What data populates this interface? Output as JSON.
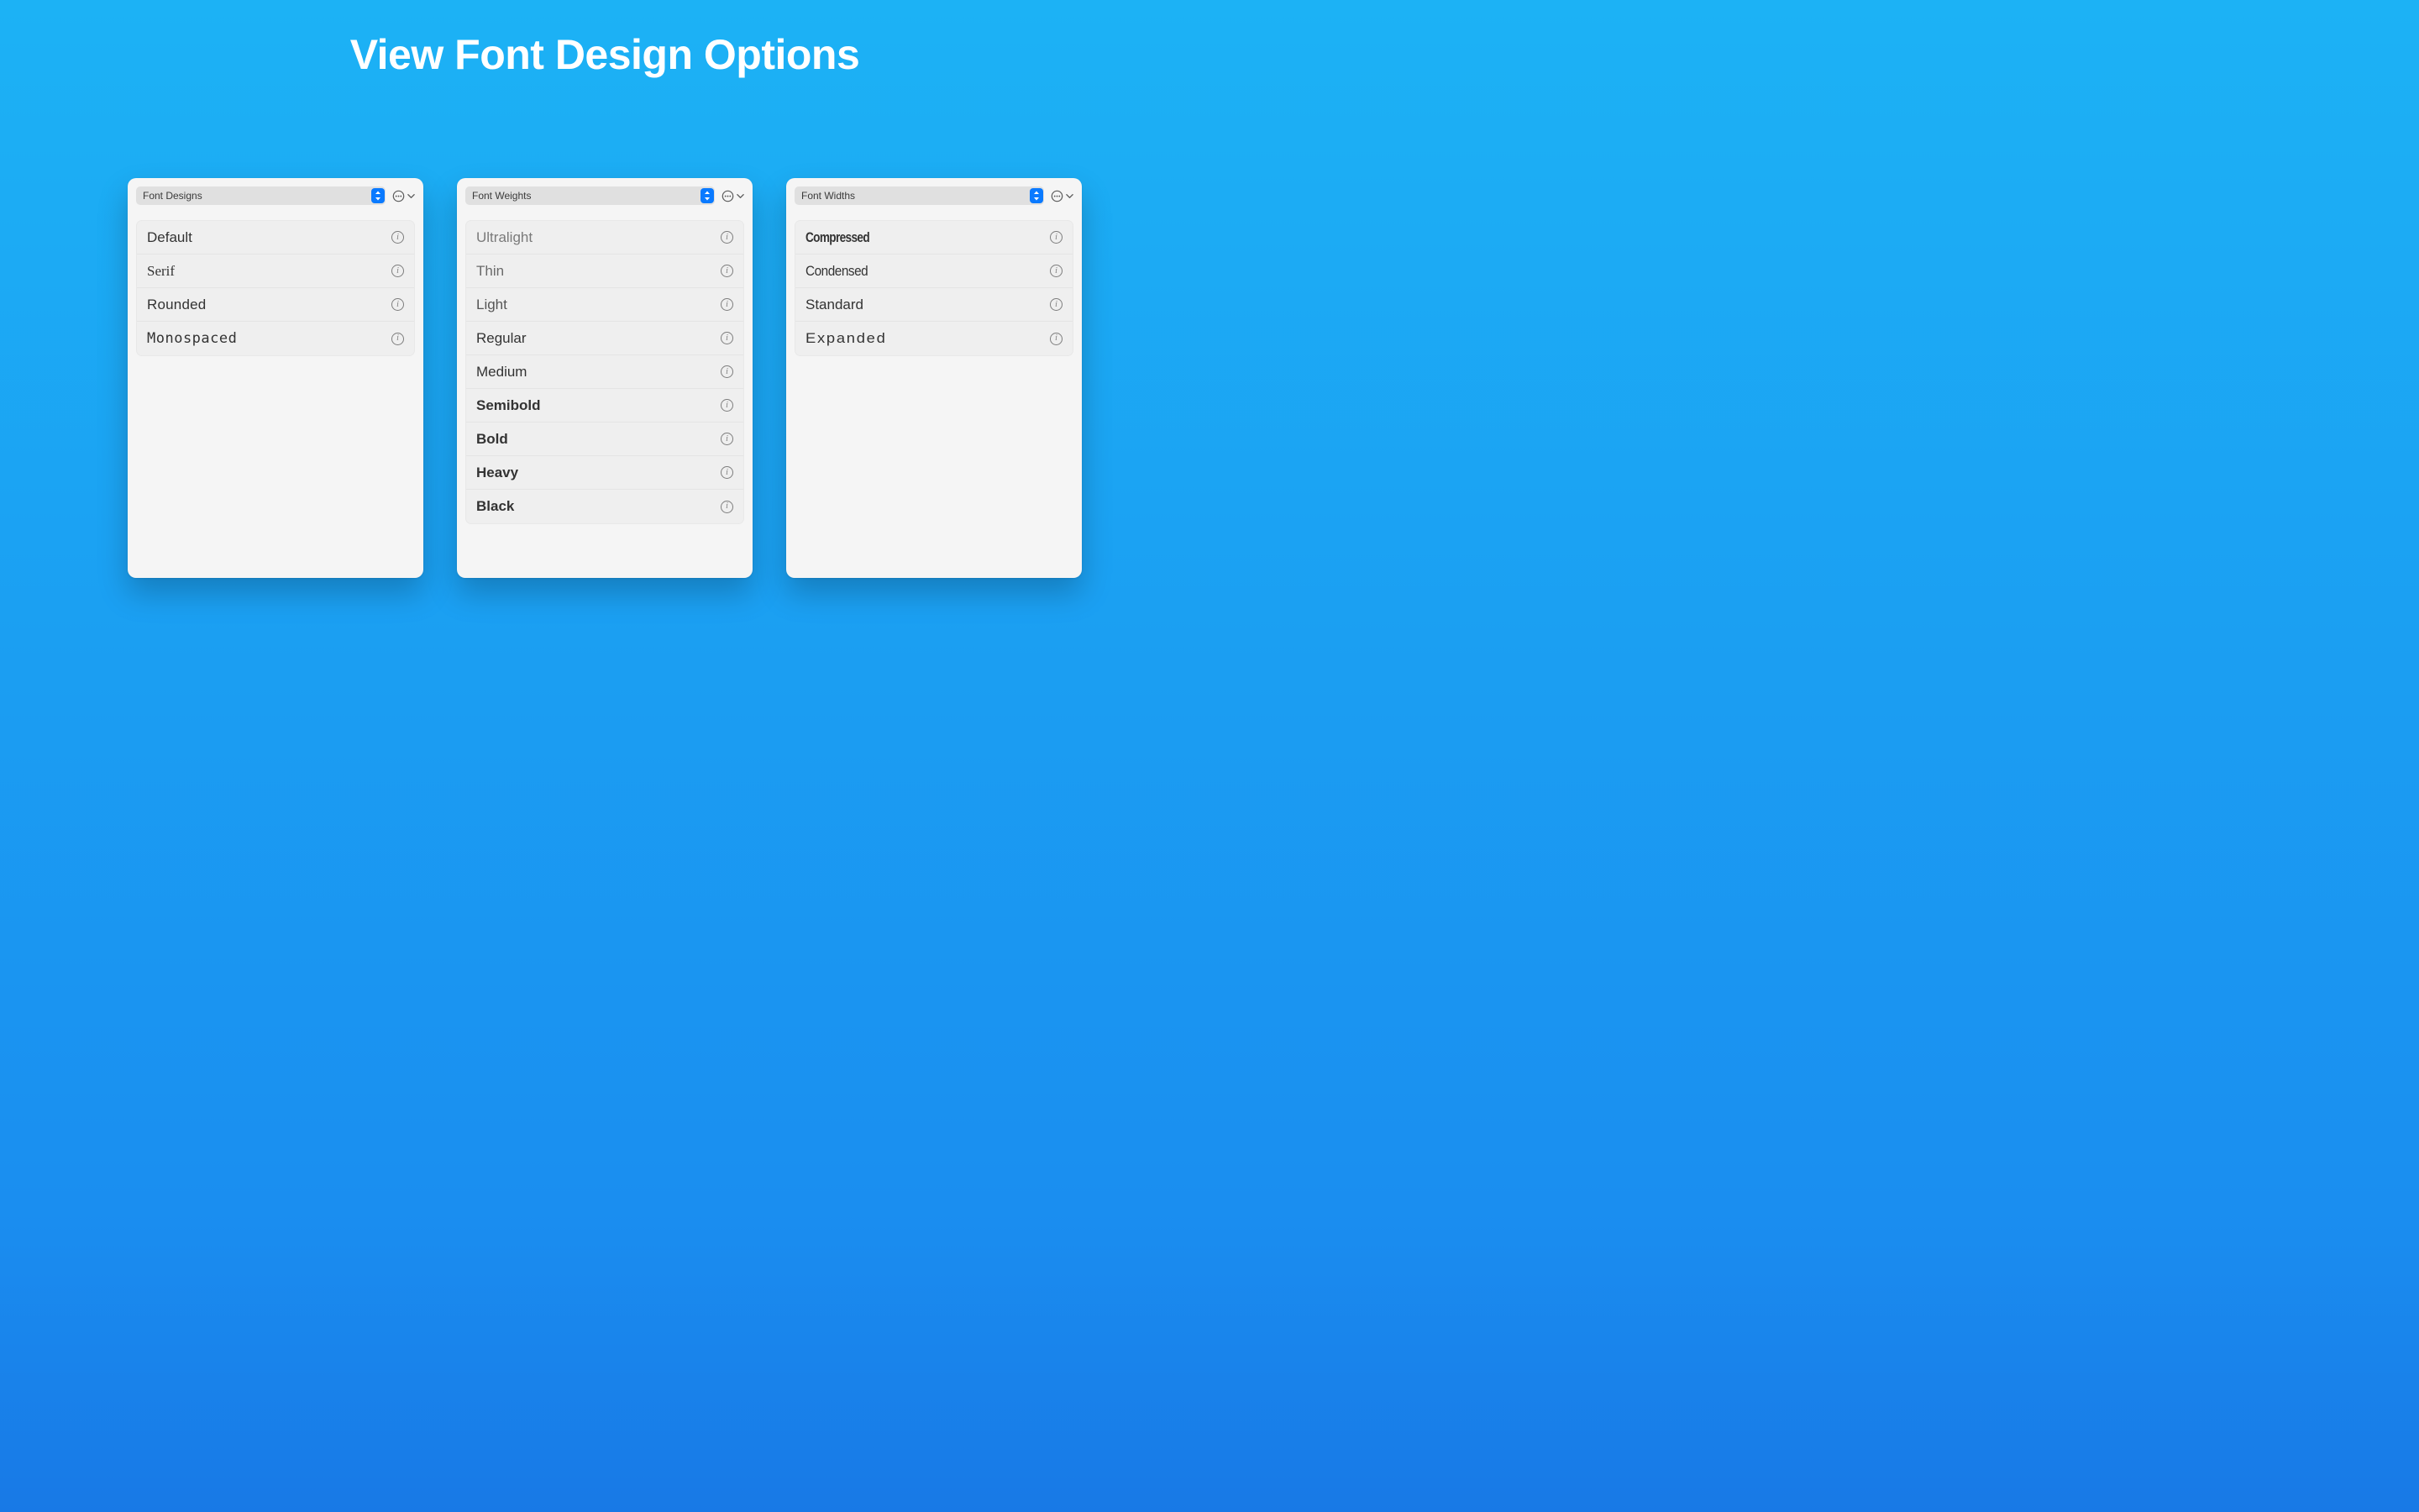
{
  "title": "View Font Design Options",
  "panels": {
    "designs": {
      "header": "Font Designs",
      "rows": [
        "Default",
        "Serif",
        "Rounded",
        "Monospaced"
      ]
    },
    "weights": {
      "header": "Font Weights",
      "rows": [
        "Ultralight",
        "Thin",
        "Light",
        "Regular",
        "Medium",
        "Semibold",
        "Bold",
        "Heavy",
        "Black"
      ]
    },
    "widths": {
      "header": "Font Widths",
      "rows": [
        "Compressed",
        "Condensed",
        "Standard",
        "Expanded"
      ]
    }
  }
}
